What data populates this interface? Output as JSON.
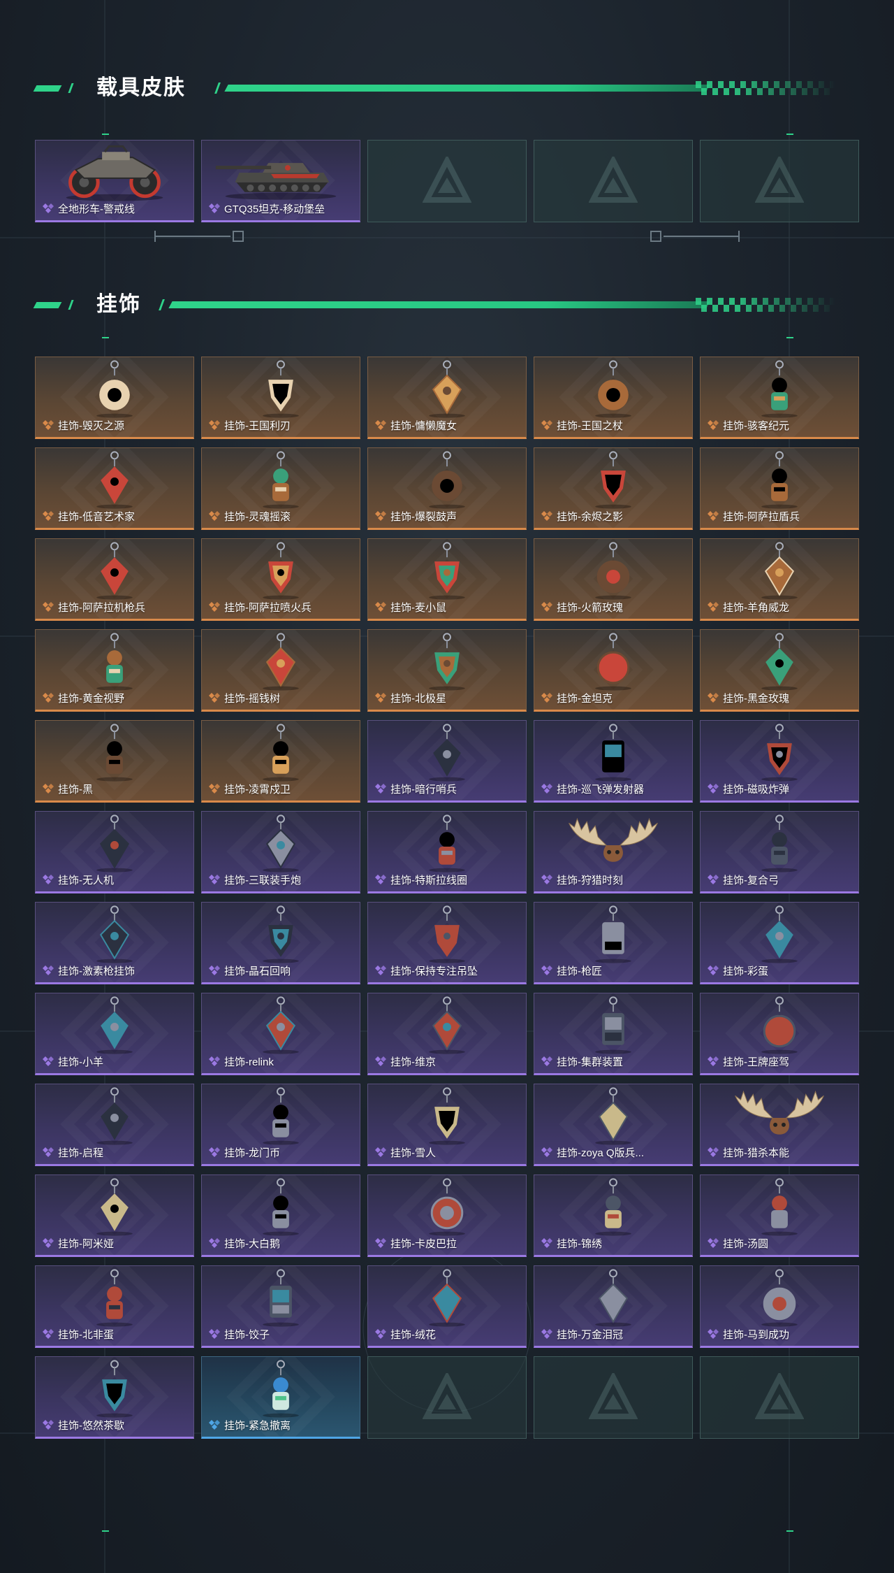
{
  "sections": [
    {
      "title": "载具皮肤",
      "items": [
        {
          "label": "全地形车-警戒线",
          "rarity": "purple",
          "icon": "atv-icon"
        },
        {
          "label": "GTQ35坦克-移动堡垒",
          "rarity": "purple",
          "icon": "tank-icon"
        },
        {
          "label": "",
          "rarity": "empty",
          "icon": "logo-placeholder-icon"
        },
        {
          "label": "",
          "rarity": "empty",
          "icon": "logo-placeholder-icon"
        },
        {
          "label": "",
          "rarity": "empty",
          "icon": "logo-placeholder-icon"
        }
      ]
    },
    {
      "title": "挂饰",
      "items": [
        {
          "label": "挂饰-毁灭之源",
          "rarity": "orange",
          "icon": "dragon-charm-icon"
        },
        {
          "label": "挂饰-王国利刃",
          "rarity": "orange",
          "icon": "knight-charm-icon"
        },
        {
          "label": "挂饰-慵懒魔女",
          "rarity": "orange",
          "icon": "witch-charm-icon"
        },
        {
          "label": "挂饰-王国之杖",
          "rarity": "orange",
          "icon": "scepter-charm-icon"
        },
        {
          "label": "挂饰-骇客纪元",
          "rarity": "orange",
          "icon": "hacker-charm-icon"
        },
        {
          "label": "挂饰-低音艺术家",
          "rarity": "orange",
          "icon": "bassist-charm-icon"
        },
        {
          "label": "挂饰-灵魂摇滚",
          "rarity": "orange",
          "icon": "rocker-charm-icon"
        },
        {
          "label": "挂饰-爆裂鼓声",
          "rarity": "orange",
          "icon": "drummer-charm-icon"
        },
        {
          "label": "挂饰-余烬之影",
          "rarity": "orange",
          "icon": "ember-charm-icon"
        },
        {
          "label": "挂饰-阿萨拉盾兵",
          "rarity": "orange",
          "icon": "shield-soldier-charm-icon"
        },
        {
          "label": "挂饰-阿萨拉机枪兵",
          "rarity": "orange",
          "icon": "gunner-charm-icon"
        },
        {
          "label": "挂饰-阿萨拉喷火兵",
          "rarity": "orange",
          "icon": "flamer-charm-icon"
        },
        {
          "label": "挂饰-麦小鼠",
          "rarity": "orange",
          "icon": "mouse-charm-icon"
        },
        {
          "label": "挂饰-火箭玫瑰",
          "rarity": "orange",
          "icon": "rocket-rose-charm-icon"
        },
        {
          "label": "挂饰-羊角威龙",
          "rarity": "orange",
          "icon": "ram-dragon-charm-icon"
        },
        {
          "label": "挂饰-黄金视野",
          "rarity": "orange",
          "icon": "golden-vision-charm-icon"
        },
        {
          "label": "挂饰-摇钱树",
          "rarity": "orange",
          "icon": "money-tree-charm-icon"
        },
        {
          "label": "挂饰-北极星",
          "rarity": "orange",
          "icon": "polaris-charm-icon"
        },
        {
          "label": "挂饰-金坦克",
          "rarity": "orange",
          "icon": "gold-tank-charm-icon"
        },
        {
          "label": "挂饰-黑金玫瑰",
          "rarity": "orange",
          "icon": "black-gold-rose-charm-icon"
        },
        {
          "label": "挂饰-黑",
          "rarity": "orange",
          "icon": "black-tag-charm-icon"
        },
        {
          "label": "挂饰-凌霄戍卫",
          "rarity": "orange",
          "icon": "guardian-charm-icon"
        },
        {
          "label": "挂饰-暗行哨兵",
          "rarity": "purple",
          "icon": "sentinel-charm-icon"
        },
        {
          "label": "挂饰-巡飞弹发射器",
          "rarity": "purple",
          "icon": "launcher-charm-icon"
        },
        {
          "label": "挂饰-磁吸炸弹",
          "rarity": "purple",
          "icon": "magnet-bomb-charm-icon"
        },
        {
          "label": "挂饰-无人机",
          "rarity": "purple",
          "icon": "drone-charm-icon"
        },
        {
          "label": "挂饰-三联装手炮",
          "rarity": "purple",
          "icon": "hand-cannon-charm-icon"
        },
        {
          "label": "挂饰-特斯拉线圈",
          "rarity": "purple",
          "icon": "tesla-coil-charm-icon"
        },
        {
          "label": "挂饰-狩猎时刻",
          "rarity": "purple",
          "icon": "antlers-charm-icon"
        },
        {
          "label": "挂饰-复合弓",
          "rarity": "purple",
          "icon": "bow-charm-icon"
        },
        {
          "label": "挂饰-激素枪挂饰",
          "rarity": "purple",
          "icon": "stim-gun-charm-icon"
        },
        {
          "label": "挂饰-晶石回响",
          "rarity": "purple",
          "icon": "crystal-charm-icon"
        },
        {
          "label": "挂饰-保持专注吊坠",
          "rarity": "purple",
          "icon": "stay-focused-charm-icon"
        },
        {
          "label": "挂饰-枪匠",
          "rarity": "purple",
          "icon": "gunsmith-charm-icon"
        },
        {
          "label": "挂饰-彩蛋",
          "rarity": "purple",
          "icon": "easter-egg-charm-icon"
        },
        {
          "label": "挂饰-小羊",
          "rarity": "purple",
          "icon": "lamb-charm-icon"
        },
        {
          "label": "挂饰-relink",
          "rarity": "purple",
          "icon": "relink-charm-icon"
        },
        {
          "label": "挂饰-维京",
          "rarity": "purple",
          "icon": "viking-hammer-charm-icon"
        },
        {
          "label": "挂饰-集群装置",
          "rarity": "purple",
          "icon": "cluster-device-charm-icon"
        },
        {
          "label": "挂饰-王牌座驾",
          "rarity": "purple",
          "icon": "jet-charm-icon"
        },
        {
          "label": "挂饰-启程",
          "rarity": "purple",
          "icon": "departure-charm-icon"
        },
        {
          "label": "挂饰-龙门币",
          "rarity": "purple",
          "icon": "coin-charm-icon"
        },
        {
          "label": "挂饰-雪人",
          "rarity": "purple",
          "icon": "snowman-charm-icon"
        },
        {
          "label": "挂饰-zoya  Q版兵...",
          "rarity": "purple",
          "icon": "zoya-charm-icon"
        },
        {
          "label": "挂饰-猎杀本能",
          "rarity": "purple",
          "icon": "moose-antlers-charm-icon"
        },
        {
          "label": "挂饰-阿米娅",
          "rarity": "purple",
          "icon": "amiya-charm-icon"
        },
        {
          "label": "挂饰-大白鹅",
          "rarity": "purple",
          "icon": "goose-charm-icon"
        },
        {
          "label": "挂饰-卡皮巴拉",
          "rarity": "purple",
          "icon": "capybara-charm-icon"
        },
        {
          "label": "挂饰-锦绣",
          "rarity": "purple",
          "icon": "butterfly-charm-icon"
        },
        {
          "label": "挂饰-汤圆",
          "rarity": "purple",
          "icon": "tangyuan-charm-icon"
        },
        {
          "label": "挂饰-北非蛋",
          "rarity": "purple",
          "icon": "shakshuka-charm-icon"
        },
        {
          "label": "挂饰-饺子",
          "rarity": "purple",
          "icon": "dumpling-charm-icon"
        },
        {
          "label": "挂饰-绒花",
          "rarity": "purple",
          "icon": "velvet-flower-charm-icon"
        },
        {
          "label": "挂饰-万金泪冠",
          "rarity": "purple",
          "icon": "crown-charm-icon"
        },
        {
          "label": "挂饰-马到成功",
          "rarity": "purple",
          "icon": "horse-charm-icon"
        },
        {
          "label": "挂饰-悠然茶歇",
          "rarity": "purple",
          "icon": "cupcake-charm-icon"
        },
        {
          "label": "挂饰-紧急撤离",
          "rarity": "blue",
          "icon": "evacuation-charm-icon"
        },
        {
          "label": "",
          "rarity": "empty",
          "icon": "logo-placeholder-icon"
        },
        {
          "label": "",
          "rarity": "empty",
          "icon": "logo-placeholder-icon"
        },
        {
          "label": "",
          "rarity": "empty",
          "icon": "logo-placeholder-icon"
        }
      ]
    }
  ],
  "colors": {
    "accent_green": "#2fd38a",
    "rarity_orange": "#d98a4a",
    "rarity_purple": "#9b79e3",
    "rarity_blue": "#4fa6e6"
  }
}
